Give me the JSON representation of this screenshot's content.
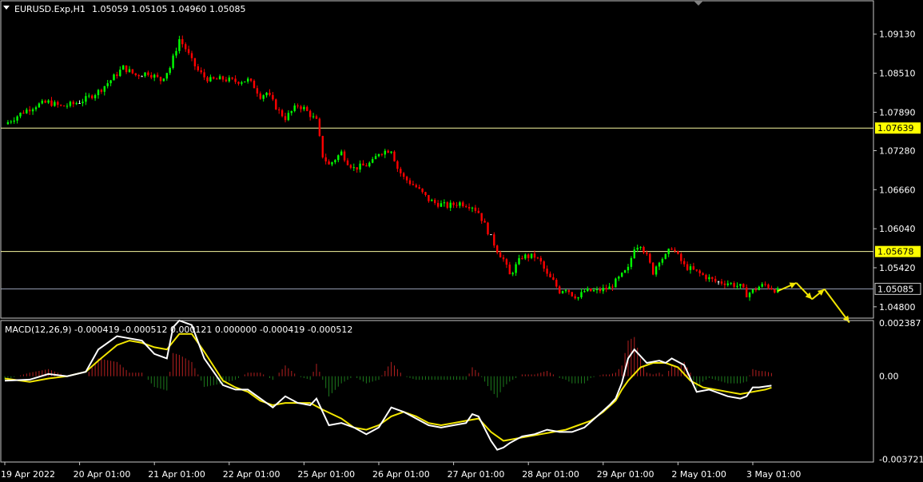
{
  "header": {
    "symbol": "EURUSD.Exp,H1",
    "ohlc": "1.05059 1.05105 1.04960 1.05085"
  },
  "indicator": {
    "title": "MACD(12,26,9) -0.000419 -0.000512 0.000121 0.000000 -0.000419 -0.000512"
  },
  "colors": {
    "background": "#000000",
    "bull": "#00ff00",
    "bear": "#ff0000",
    "doji": "#ffffff",
    "hline": "#f7f7a0",
    "current_line": "#9aa3b8",
    "arrow": "#f2e600",
    "macd_line": "#ffffff",
    "signal_line": "#f2e600",
    "hist_pos": "#b52020",
    "hist_neg": "#1d7a1d",
    "label_highlight_bg": "#ffff00"
  },
  "chart_data": [
    {
      "type": "candlestick",
      "symbol": "EURUSD.Exp",
      "timeframe": "H1",
      "ylim": [
        1.0462,
        1.0966
      ],
      "yticks": [
        "1.09130",
        "1.08510",
        "1.07890",
        "1.07280",
        "1.06660",
        "1.06040",
        "1.05420",
        "1.04800"
      ],
      "xticks": [
        "19 Apr 2022",
        "20 Apr 01:00",
        "21 Apr 01:00",
        "22 Apr 01:00",
        "25 Apr 01:00",
        "26 Apr 01:00",
        "27 Apr 01:00",
        "28 Apr 01:00",
        "29 Apr 01:00",
        "2 May 01:00",
        "3 May 01:00"
      ],
      "horizontal_lines": [
        {
          "price": 1.07639,
          "label": "1.07639",
          "highlight": true
        },
        {
          "price": 1.05678,
          "label": "1.05678",
          "highlight": true
        },
        {
          "price": 1.05085,
          "label": "1.05085",
          "highlight": false,
          "current": true
        }
      ],
      "close_path": [
        [
          0,
          1.077
        ],
        [
          6,
          1.079
        ],
        [
          10,
          1.08
        ],
        [
          14,
          1.0805
        ],
        [
          18,
          1.0798
        ],
        [
          22,
          1.0802
        ],
        [
          26,
          1.081
        ],
        [
          30,
          1.0822
        ],
        [
          34,
          1.084
        ],
        [
          38,
          1.086
        ],
        [
          42,
          1.0848
        ],
        [
          46,
          1.0852
        ],
        [
          50,
          1.084
        ],
        [
          53,
          1.086
        ],
        [
          56,
          1.0905
        ],
        [
          58,
          1.089
        ],
        [
          60,
          1.087
        ],
        [
          62,
          1.0855
        ],
        [
          64,
          1.0845
        ],
        [
          66,
          1.084
        ],
        [
          70,
          1.0842
        ],
        [
          74,
          1.0838
        ],
        [
          78,
          1.084
        ],
        [
          80,
          1.083
        ],
        [
          82,
          1.0815
        ],
        [
          84,
          1.082
        ],
        [
          86,
          1.0805
        ],
        [
          88,
          1.079
        ],
        [
          90,
          1.078
        ],
        [
          92,
          1.079
        ],
        [
          94,
          1.08
        ],
        [
          96,
          1.0795
        ],
        [
          98,
          1.0785
        ],
        [
          100,
          1.0775
        ],
        [
          102,
          1.072
        ],
        [
          104,
          1.0705
        ],
        [
          106,
          1.0715
        ],
        [
          108,
          1.0725
        ],
        [
          110,
          1.071
        ],
        [
          112,
          1.07
        ],
        [
          116,
          1.0705
        ],
        [
          118,
          1.071
        ],
        [
          120,
          1.0725
        ],
        [
          124,
          1.073
        ],
        [
          126,
          1.07
        ],
        [
          128,
          1.0685
        ],
        [
          132,
          1.067
        ],
        [
          134,
          1.066
        ],
        [
          136,
          1.065
        ],
        [
          138,
          1.0645
        ],
        [
          142,
          1.064
        ],
        [
          146,
          1.0645
        ],
        [
          150,
          1.064
        ],
        [
          152,
          1.063
        ],
        [
          154,
          1.061
        ],
        [
          156,
          1.059
        ],
        [
          158,
          1.057
        ],
        [
          160,
          1.0555
        ],
        [
          162,
          1.053
        ],
        [
          164,
          1.0545
        ],
        [
          166,
          1.056
        ],
        [
          170,
          1.056
        ],
        [
          172,
          1.055
        ],
        [
          174,
          1.053
        ],
        [
          176,
          1.052
        ],
        [
          178,
          1.0505
        ],
        [
          180,
          1.051
        ],
        [
          182,
          1.05
        ],
        [
          184,
          1.0495
        ],
        [
          186,
          1.0505
        ],
        [
          190,
          1.0505
        ],
        [
          194,
          1.051
        ],
        [
          196,
          1.052
        ],
        [
          200,
          1.054
        ],
        [
          202,
          1.0575
        ],
        [
          204,
          1.058
        ],
        [
          206,
          1.056
        ],
        [
          208,
          1.0535
        ],
        [
          210,
          1.0555
        ],
        [
          212,
          1.056
        ],
        [
          214,
          1.0575
        ],
        [
          216,
          1.056
        ],
        [
          218,
          1.0545
        ],
        [
          222,
          1.0535
        ],
        [
          226,
          1.0525
        ],
        [
          228,
          1.052
        ],
        [
          232,
          1.0518
        ],
        [
          236,
          1.0512
        ],
        [
          238,
          1.05
        ],
        [
          240,
          1.0505
        ],
        [
          242,
          1.0512
        ],
        [
          244,
          1.0515
        ],
        [
          246,
          1.051
        ],
        [
          248,
          1.0505
        ]
      ],
      "forecast_arrows": [
        [
          [
            248,
            1.0505
          ],
          [
            254,
            1.0518
          ]
        ],
        [
          [
            254,
            1.0518
          ],
          [
            259,
            1.0492
          ]
        ],
        [
          [
            259,
            1.0492
          ],
          [
            263,
            1.0508
          ]
        ],
        [
          [
            263,
            1.0508
          ],
          [
            271,
            1.0455
          ]
        ]
      ]
    },
    {
      "type": "macd",
      "params": "12,26,9",
      "ylim": [
        -0.00385,
        0.0025
      ],
      "yticks": [
        "0.002387",
        "0.00",
        "-0.003721"
      ],
      "macd_path": [
        [
          0,
          -0.0002
        ],
        [
          8,
          -0.00015
        ],
        [
          14,
          0.0001
        ],
        [
          20,
          0.0
        ],
        [
          26,
          0.0002
        ],
        [
          30,
          0.0012
        ],
        [
          36,
          0.0018
        ],
        [
          40,
          0.0017
        ],
        [
          44,
          0.0016
        ],
        [
          48,
          0.001
        ],
        [
          52,
          0.0008
        ],
        [
          54,
          0.0022
        ],
        [
          56,
          0.0025
        ],
        [
          60,
          0.0023
        ],
        [
          64,
          0.0008
        ],
        [
          70,
          -0.0004
        ],
        [
          74,
          -0.0006
        ],
        [
          78,
          -0.0006
        ],
        [
          82,
          -0.001
        ],
        [
          86,
          -0.0014
        ],
        [
          90,
          -0.0009
        ],
        [
          94,
          -0.0012
        ],
        [
          98,
          -0.0013
        ],
        [
          100,
          -0.001
        ],
        [
          104,
          -0.0022
        ],
        [
          108,
          -0.0021
        ],
        [
          112,
          -0.0023
        ],
        [
          116,
          -0.0026
        ],
        [
          120,
          -0.0023
        ],
        [
          124,
          -0.0014
        ],
        [
          128,
          -0.0016
        ],
        [
          132,
          -0.0019
        ],
        [
          136,
          -0.0022
        ],
        [
          140,
          -0.0023
        ],
        [
          144,
          -0.0022
        ],
        [
          148,
          -0.0021
        ],
        [
          150,
          -0.0017
        ],
        [
          152,
          -0.0018
        ],
        [
          156,
          -0.0029
        ],
        [
          158,
          -0.0033
        ],
        [
          160,
          -0.0032
        ],
        [
          162,
          -0.003
        ],
        [
          166,
          -0.0027
        ],
        [
          170,
          -0.0026
        ],
        [
          174,
          -0.0024
        ],
        [
          178,
          -0.0025
        ],
        [
          182,
          -0.0025
        ],
        [
          186,
          -0.0023
        ],
        [
          190,
          -0.0018
        ],
        [
          194,
          -0.0013
        ],
        [
          196,
          -0.001
        ],
        [
          198,
          -0.0003
        ],
        [
          200,
          0.0008
        ],
        [
          202,
          0.0012
        ],
        [
          206,
          0.0006
        ],
        [
          210,
          0.0007
        ],
        [
          212,
          0.0006
        ],
        [
          214,
          0.0008
        ],
        [
          218,
          0.0005
        ],
        [
          222,
          -0.0007
        ],
        [
          226,
          -0.0006
        ],
        [
          232,
          -0.0009
        ],
        [
          236,
          -0.001
        ],
        [
          238,
          -0.0009
        ],
        [
          240,
          -0.0005
        ],
        [
          242,
          -0.0005
        ],
        [
          246,
          -0.00042
        ]
      ],
      "signal_path": [
        [
          0,
          -0.0001
        ],
        [
          8,
          -0.00025
        ],
        [
          14,
          -0.0001
        ],
        [
          20,
          0.0
        ],
        [
          26,
          0.0002
        ],
        [
          30,
          0.0007
        ],
        [
          36,
          0.0014
        ],
        [
          40,
          0.0016
        ],
        [
          44,
          0.0015
        ],
        [
          48,
          0.0013
        ],
        [
          52,
          0.0012
        ],
        [
          56,
          0.0019
        ],
        [
          60,
          0.0019
        ],
        [
          64,
          0.0011
        ],
        [
          70,
          -0.0002
        ],
        [
          74,
          -0.0005
        ],
        [
          78,
          -0.0007
        ],
        [
          82,
          -0.0011
        ],
        [
          86,
          -0.0013
        ],
        [
          90,
          -0.0012
        ],
        [
          94,
          -0.0012
        ],
        [
          98,
          -0.0012
        ],
        [
          102,
          -0.0015
        ],
        [
          108,
          -0.0019
        ],
        [
          112,
          -0.0023
        ],
        [
          116,
          -0.0024
        ],
        [
          120,
          -0.0022
        ],
        [
          124,
          -0.0018
        ],
        [
          128,
          -0.0016
        ],
        [
          132,
          -0.0018
        ],
        [
          136,
          -0.0021
        ],
        [
          140,
          -0.0022
        ],
        [
          144,
          -0.0021
        ],
        [
          148,
          -0.002
        ],
        [
          152,
          -0.0019
        ],
        [
          156,
          -0.0025
        ],
        [
          160,
          -0.0029
        ],
        [
          164,
          -0.0028
        ],
        [
          168,
          -0.0027
        ],
        [
          172,
          -0.0026
        ],
        [
          176,
          -0.0025
        ],
        [
          180,
          -0.0024
        ],
        [
          184,
          -0.0022
        ],
        [
          188,
          -0.002
        ],
        [
          192,
          -0.0016
        ],
        [
          196,
          -0.0011
        ],
        [
          198,
          -0.0006
        ],
        [
          200,
          -0.0002
        ],
        [
          204,
          0.0004
        ],
        [
          208,
          0.0006
        ],
        [
          212,
          0.0006
        ],
        [
          216,
          0.0004
        ],
        [
          220,
          -0.0002
        ],
        [
          224,
          -0.0005
        ],
        [
          228,
          -0.0006
        ],
        [
          232,
          -0.0007
        ],
        [
          236,
          -0.0008
        ],
        [
          240,
          -0.0007
        ],
        [
          244,
          -0.0006
        ],
        [
          246,
          -0.00051
        ]
      ]
    }
  ]
}
